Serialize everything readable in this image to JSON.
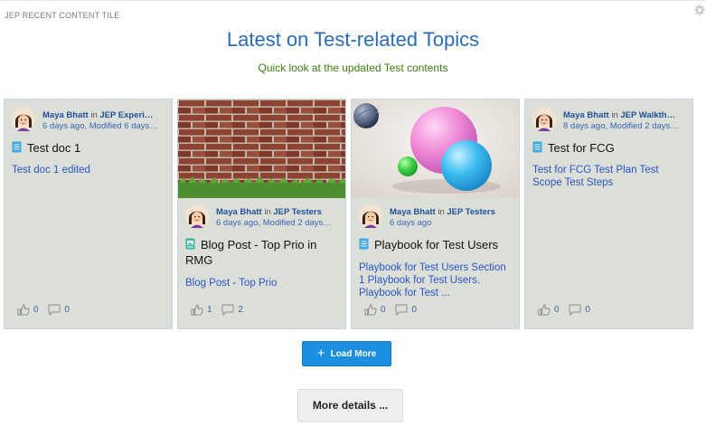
{
  "tile_label": "JEP RECENT CONTENT TILE",
  "title": "Latest on Test-related Topics",
  "subtitle": "Quick look at the updated Test contents",
  "cards": [
    {
      "author": "Maya Bhatt",
      "in_word": "in",
      "place": "JEP Experi…",
      "date": "6 days ago, Modified 6 days…",
      "type_icon": "document-icon",
      "title": "Test doc 1",
      "excerpt": "Test doc 1 edited",
      "likes": "0",
      "comments": "0"
    },
    {
      "image": "brick-wall-image",
      "author": "Maya Bhatt",
      "in_word": "in",
      "place": "JEP Testers",
      "date": "6 days ago, Modified 2 days…",
      "type_icon": "blog-icon",
      "title": "Blog Post - Top Prio in RMG",
      "excerpt": "Blog Post - Top Prio",
      "likes": "1",
      "comments": "2"
    },
    {
      "image": "spheres-render-image",
      "author": "Maya Bhatt",
      "in_word": "in",
      "place": "JEP Testers",
      "date": "6 days ago",
      "type_icon": "document-icon",
      "title": "Playbook for Test Users",
      "excerpt": "Playbook for Test Users  Section 1  Playbook for Test Users. Playbook for Test ...",
      "likes": "0",
      "comments": "0"
    },
    {
      "author": "Maya Bhatt",
      "in_word": "in",
      "place": "JEP Walkth…",
      "date": "8 days ago, Modified 2 days…",
      "type_icon": "document-icon",
      "title": "Test for FCG",
      "excerpt": "Test for FCG  Test Plan Test Scope Test Steps",
      "likes": "0",
      "comments": "0"
    }
  ],
  "load_more_label": "Load More",
  "more_details_label": "More details ...",
  "colors": {
    "title": "#2b6cb8",
    "subtitle": "#3e7d0f",
    "card_bg": "#dcdfd7",
    "link": "#2856c8",
    "button": "#1d8fe1"
  }
}
